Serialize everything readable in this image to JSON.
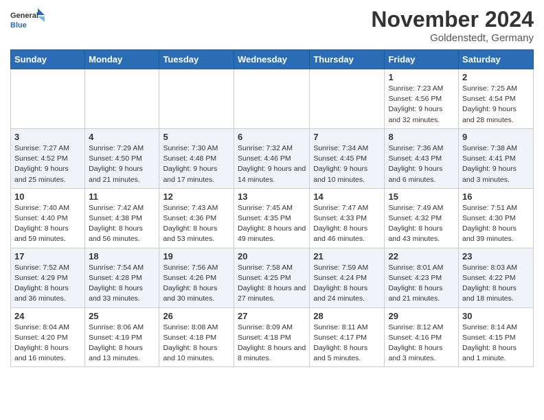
{
  "header": {
    "logo_general": "General",
    "logo_blue": "Blue",
    "main_title": "November 2024",
    "subtitle": "Goldenstedt, Germany"
  },
  "calendar": {
    "headers": [
      "Sunday",
      "Monday",
      "Tuesday",
      "Wednesday",
      "Thursday",
      "Friday",
      "Saturday"
    ],
    "rows": [
      [
        {
          "day": "",
          "info": ""
        },
        {
          "day": "",
          "info": ""
        },
        {
          "day": "",
          "info": ""
        },
        {
          "day": "",
          "info": ""
        },
        {
          "day": "",
          "info": ""
        },
        {
          "day": "1",
          "info": "Sunrise: 7:23 AM\nSunset: 4:56 PM\nDaylight: 9 hours and 32 minutes."
        },
        {
          "day": "2",
          "info": "Sunrise: 7:25 AM\nSunset: 4:54 PM\nDaylight: 9 hours and 28 minutes."
        }
      ],
      [
        {
          "day": "3",
          "info": "Sunrise: 7:27 AM\nSunset: 4:52 PM\nDaylight: 9 hours and 25 minutes."
        },
        {
          "day": "4",
          "info": "Sunrise: 7:29 AM\nSunset: 4:50 PM\nDaylight: 9 hours and 21 minutes."
        },
        {
          "day": "5",
          "info": "Sunrise: 7:30 AM\nSunset: 4:48 PM\nDaylight: 9 hours and 17 minutes."
        },
        {
          "day": "6",
          "info": "Sunrise: 7:32 AM\nSunset: 4:46 PM\nDaylight: 9 hours and 14 minutes."
        },
        {
          "day": "7",
          "info": "Sunrise: 7:34 AM\nSunset: 4:45 PM\nDaylight: 9 hours and 10 minutes."
        },
        {
          "day": "8",
          "info": "Sunrise: 7:36 AM\nSunset: 4:43 PM\nDaylight: 9 hours and 6 minutes."
        },
        {
          "day": "9",
          "info": "Sunrise: 7:38 AM\nSunset: 4:41 PM\nDaylight: 9 hours and 3 minutes."
        }
      ],
      [
        {
          "day": "10",
          "info": "Sunrise: 7:40 AM\nSunset: 4:40 PM\nDaylight: 8 hours and 59 minutes."
        },
        {
          "day": "11",
          "info": "Sunrise: 7:42 AM\nSunset: 4:38 PM\nDaylight: 8 hours and 56 minutes."
        },
        {
          "day": "12",
          "info": "Sunrise: 7:43 AM\nSunset: 4:36 PM\nDaylight: 8 hours and 53 minutes."
        },
        {
          "day": "13",
          "info": "Sunrise: 7:45 AM\nSunset: 4:35 PM\nDaylight: 8 hours and 49 minutes."
        },
        {
          "day": "14",
          "info": "Sunrise: 7:47 AM\nSunset: 4:33 PM\nDaylight: 8 hours and 46 minutes."
        },
        {
          "day": "15",
          "info": "Sunrise: 7:49 AM\nSunset: 4:32 PM\nDaylight: 8 hours and 43 minutes."
        },
        {
          "day": "16",
          "info": "Sunrise: 7:51 AM\nSunset: 4:30 PM\nDaylight: 8 hours and 39 minutes."
        }
      ],
      [
        {
          "day": "17",
          "info": "Sunrise: 7:52 AM\nSunset: 4:29 PM\nDaylight: 8 hours and 36 minutes."
        },
        {
          "day": "18",
          "info": "Sunrise: 7:54 AM\nSunset: 4:28 PM\nDaylight: 8 hours and 33 minutes."
        },
        {
          "day": "19",
          "info": "Sunrise: 7:56 AM\nSunset: 4:26 PM\nDaylight: 8 hours and 30 minutes."
        },
        {
          "day": "20",
          "info": "Sunrise: 7:58 AM\nSunset: 4:25 PM\nDaylight: 8 hours and 27 minutes."
        },
        {
          "day": "21",
          "info": "Sunrise: 7:59 AM\nSunset: 4:24 PM\nDaylight: 8 hours and 24 minutes."
        },
        {
          "day": "22",
          "info": "Sunrise: 8:01 AM\nSunset: 4:23 PM\nDaylight: 8 hours and 21 minutes."
        },
        {
          "day": "23",
          "info": "Sunrise: 8:03 AM\nSunset: 4:22 PM\nDaylight: 8 hours and 18 minutes."
        }
      ],
      [
        {
          "day": "24",
          "info": "Sunrise: 8:04 AM\nSunset: 4:20 PM\nDaylight: 8 hours and 16 minutes."
        },
        {
          "day": "25",
          "info": "Sunrise: 8:06 AM\nSunset: 4:19 PM\nDaylight: 8 hours and 13 minutes."
        },
        {
          "day": "26",
          "info": "Sunrise: 8:08 AM\nSunset: 4:18 PM\nDaylight: 8 hours and 10 minutes."
        },
        {
          "day": "27",
          "info": "Sunrise: 8:09 AM\nSunset: 4:18 PM\nDaylight: 8 hours and 8 minutes."
        },
        {
          "day": "28",
          "info": "Sunrise: 8:11 AM\nSunset: 4:17 PM\nDaylight: 8 hours and 5 minutes."
        },
        {
          "day": "29",
          "info": "Sunrise: 8:12 AM\nSunset: 4:16 PM\nDaylight: 8 hours and 3 minutes."
        },
        {
          "day": "30",
          "info": "Sunrise: 8:14 AM\nSunset: 4:15 PM\nDaylight: 8 hours and 1 minute."
        }
      ]
    ]
  }
}
